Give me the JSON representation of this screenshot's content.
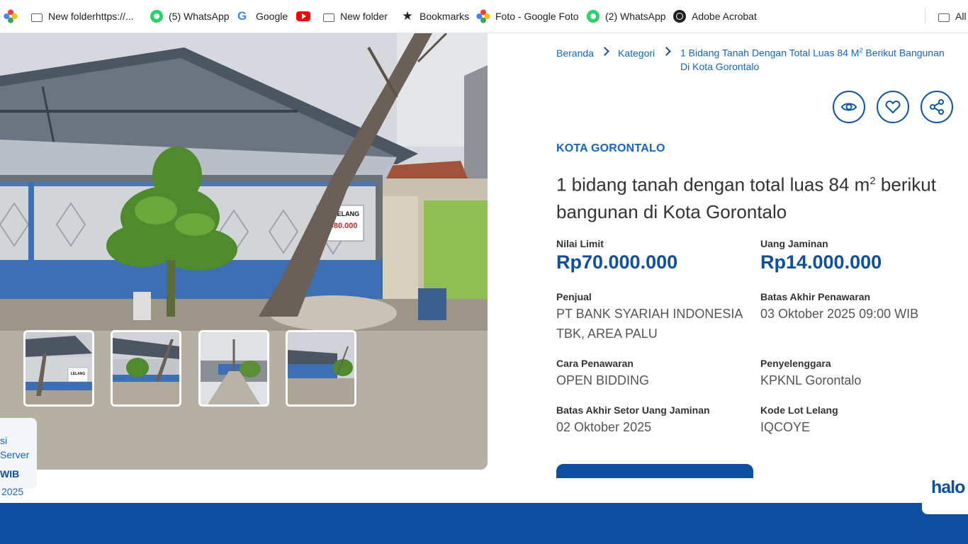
{
  "bookmarks_bar": {
    "items": [
      {
        "label": "",
        "icon": "photos-pinwheel-icon"
      },
      {
        "label": "New folderhttps://...",
        "icon": "folder-icon"
      },
      {
        "label": "(5) WhatsApp",
        "icon": "whatsapp-icon"
      },
      {
        "label": "Google",
        "icon": "google-icon"
      },
      {
        "label": "",
        "icon": "youtube-icon"
      },
      {
        "label": "New folder",
        "icon": "folder-icon"
      },
      {
        "label": "Bookmarks",
        "icon": "star-icon"
      },
      {
        "label": "Foto - Google Foto",
        "icon": "photos-pinwheel-icon"
      },
      {
        "label": "(2) WhatsApp",
        "icon": "whatsapp-icon"
      },
      {
        "label": "Adobe Acrobat",
        "icon": "globe-icon"
      },
      {
        "label": "All",
        "icon": "folder-icon"
      }
    ]
  },
  "gallery": {
    "sign_line1": "VIA LELANG",
    "sign_line2": "8.080.000",
    "thumb_sign": "LELANG"
  },
  "side_panel": {
    "line1": "si",
    "line2": "Server",
    "line3": "WIB",
    "line4": "2025"
  },
  "breadcrumb": {
    "home": "Beranda",
    "category": "Kategori",
    "current_line1": "1 Bidang Tanah Dengan Total Luas 84 M",
    "current_sup": "2",
    "current_after": " Berikut Bangunan",
    "current_line2": "Di Kota Gorontalo"
  },
  "actions": {
    "view_icon": "eye-icon",
    "favorite_icon": "heart-icon",
    "share_icon": "share-icon"
  },
  "listing": {
    "location": "KOTA GORONTALO",
    "title_line1_a": "1 bidang tanah dengan total luas 84 m",
    "title_sup": "2",
    "title_line1_b": " berikut",
    "title_line2": "bangunan di Kota Gorontalo",
    "nilai_limit_label": "Nilai Limit",
    "nilai_limit_value": "Rp70.000.000",
    "uang_jaminan_label": "Uang Jaminan",
    "uang_jaminan_value": "Rp14.000.000",
    "penjual_label": "Penjual",
    "penjual_line1": "PT BANK SYARIAH INDONESIA",
    "penjual_line2": "TBK, AREA PALU",
    "batas_penawaran_label": "Batas Akhir Penawaran",
    "batas_penawaran_value": "03 Oktober 2025 09:00 WIB",
    "cara_label": "Cara Penawaran",
    "cara_value": "OPEN BIDDING",
    "penyelenggara_label": "Penyelenggara",
    "penyelenggara_value": "KPKNL Gorontalo",
    "setor_label": "Batas Akhir Setor Uang Jaminan",
    "setor_value": "02 Oktober 2025",
    "kode_label": "Kode Lot Lelang",
    "kode_value": "IQCOYE"
  },
  "brand": {
    "logo_text": "halo",
    "primary_color": "#0d4fa3"
  }
}
